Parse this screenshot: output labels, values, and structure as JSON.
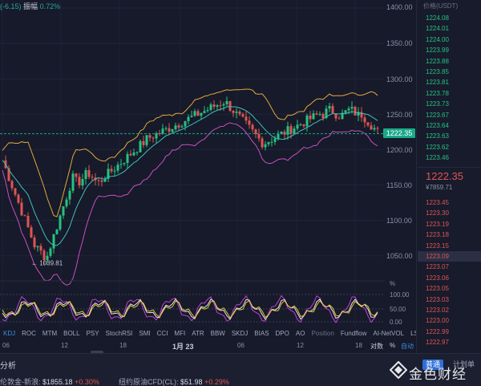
{
  "header": {
    "change_text": "(-6.15)",
    "amp_label": "振幅",
    "amp_value": "0.72%"
  },
  "price_axis": {
    "labels": [
      "1400.00",
      "1350.00",
      "1300.00",
      "1250.00",
      "1200.00",
      "1150.00",
      "1100.00",
      "1050.00"
    ],
    "current_price": "1222.35"
  },
  "low_annotation": "1039.81",
  "oscillator_axis": {
    "labels": [
      "100.00",
      "50.00",
      "0.00"
    ],
    "percent": "%"
  },
  "indicator_tabs": [
    "KDJ",
    "ROC",
    "MTM",
    "BOLL",
    "PSY",
    "StochRSI",
    "SMI",
    "CCI",
    "MFI",
    "ATR",
    "BBW",
    "SKDJ",
    "BIAS",
    "DPO",
    "AO",
    "Position",
    "Fundflow",
    "AI-NetVOL",
    "LSUR"
  ],
  "time_axis": {
    "labels": [
      "06",
      "12",
      "18",
      "1月 23",
      "06",
      "12",
      "18"
    ],
    "right_label": "对数",
    "pct": "%",
    "auto": "自动"
  },
  "order_book": {
    "header": "价格(USDT)",
    "asks": [
      "1224.08",
      "1224.01",
      "1224.00",
      "1223.99",
      "1223.88",
      "1223.85",
      "1223.81",
      "1223.78",
      "1223.73",
      "1223.67",
      "1223.64",
      "1223.63",
      "1223.62",
      "1223.46"
    ],
    "last_price": "1222.35",
    "last_price_fiat": "¥7859.71",
    "bids": [
      "1223.45",
      "1223.30",
      "1223.19",
      "1223.18",
      "1223.15",
      "1223.09",
      "1223.07",
      "1223.06",
      "1223.05",
      "1223.03",
      "1223.02",
      "1223.00",
      "1222.99",
      "1222.97"
    ]
  },
  "bottom_bar": {
    "analysis": "分析",
    "tickers": [
      {
        "name": "伦敦金-新浪:",
        "value": "$1855.18",
        "change": "+0.30%"
      },
      {
        "name": "纽约原油CFD(CL):",
        "value": "$51.98",
        "change": "+0.29%"
      }
    ],
    "mode_button": "普通",
    "plan": "计划单",
    "logo_text": "金色财经"
  },
  "colors": {
    "up": "#26c281",
    "down": "#e05454",
    "boll_upper": "#e2a93b",
    "boll_mid": "#3fc1b5",
    "boll_lower": "#c94fbf",
    "accent": "#2f6fd8"
  }
}
